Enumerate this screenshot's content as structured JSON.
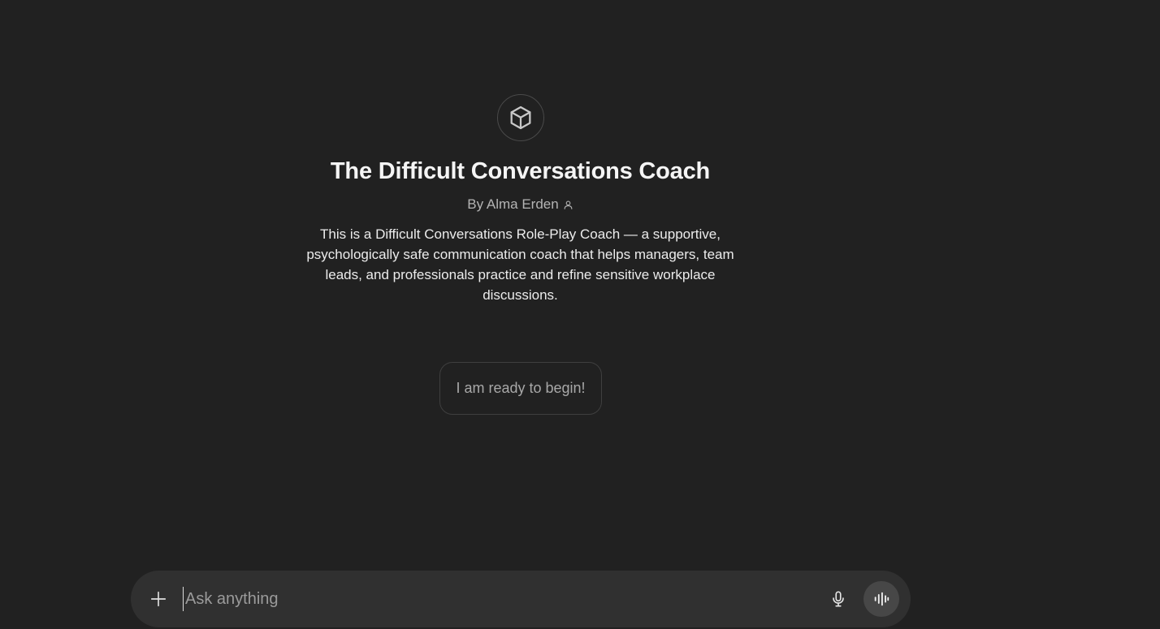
{
  "gpt": {
    "title": "The Difficult Conversations Coach",
    "author": "By Alma Erden",
    "description": "This is a Difficult Conversations Role-Play Coach — a supportive, psychologically safe communication coach that helps managers, team leads, and professionals practice and refine sensitive workplace discussions.",
    "avatar_icon": "cube-icon",
    "author_icon": "person-icon"
  },
  "starters": [
    {
      "label": "I am ready to begin!"
    }
  ],
  "composer": {
    "placeholder": "Ask anything",
    "value": "",
    "add_icon": "plus-icon",
    "mic_icon": "microphone-icon",
    "voice_icon": "voice-waveform-icon"
  },
  "colors": {
    "background": "#212121",
    "composer": "#303030",
    "voice_button": "#474747",
    "chip_border": "#3f3f3f"
  }
}
